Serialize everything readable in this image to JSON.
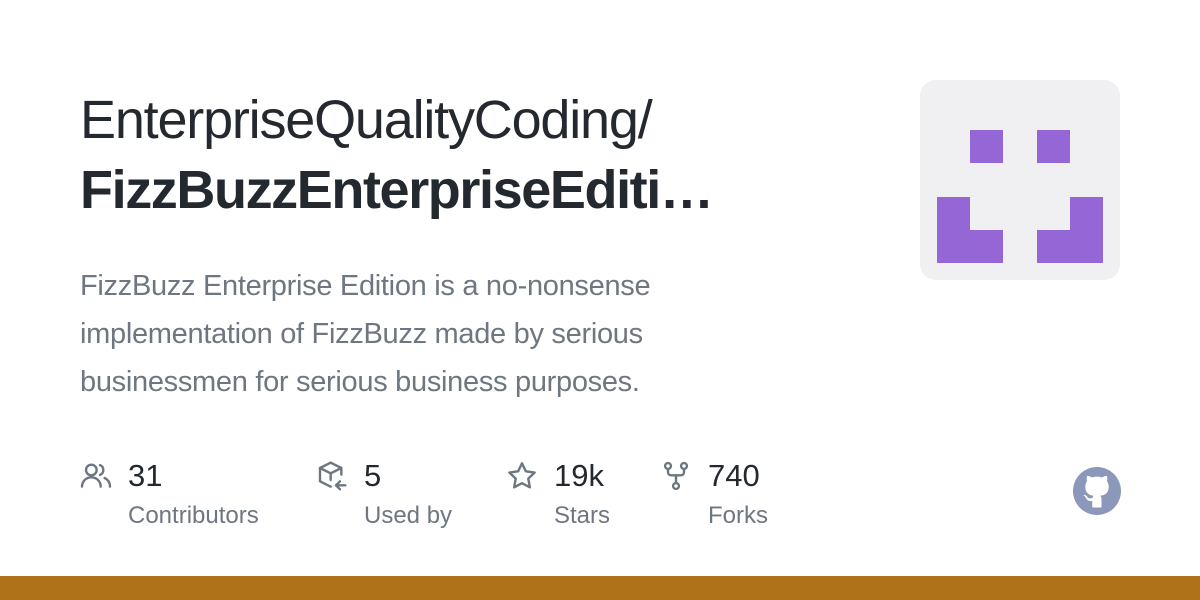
{
  "repo": {
    "owner": "EnterpriseQualityCoding/",
    "name": "FizzBuzzEnterpriseEditi…",
    "description": "FizzBuzz Enterprise Edition is a no-nonsense implementation of FizzBuzz made by serious businessmen for serious business purposes."
  },
  "avatar": {
    "icon": "identicon",
    "background": "#f0f0f2",
    "color": "#9566d6"
  },
  "stats": [
    {
      "icon": "people-icon",
      "value": "31",
      "label": "Contributors"
    },
    {
      "icon": "package-dependents-icon",
      "value": "5",
      "label": "Used by"
    },
    {
      "icon": "star-icon",
      "value": "19k",
      "label": "Stars"
    },
    {
      "icon": "repo-forked-icon",
      "value": "740",
      "label": "Forks"
    }
  ],
  "footer": {
    "logo": "github-mark-icon",
    "language_color": "#b07219"
  }
}
